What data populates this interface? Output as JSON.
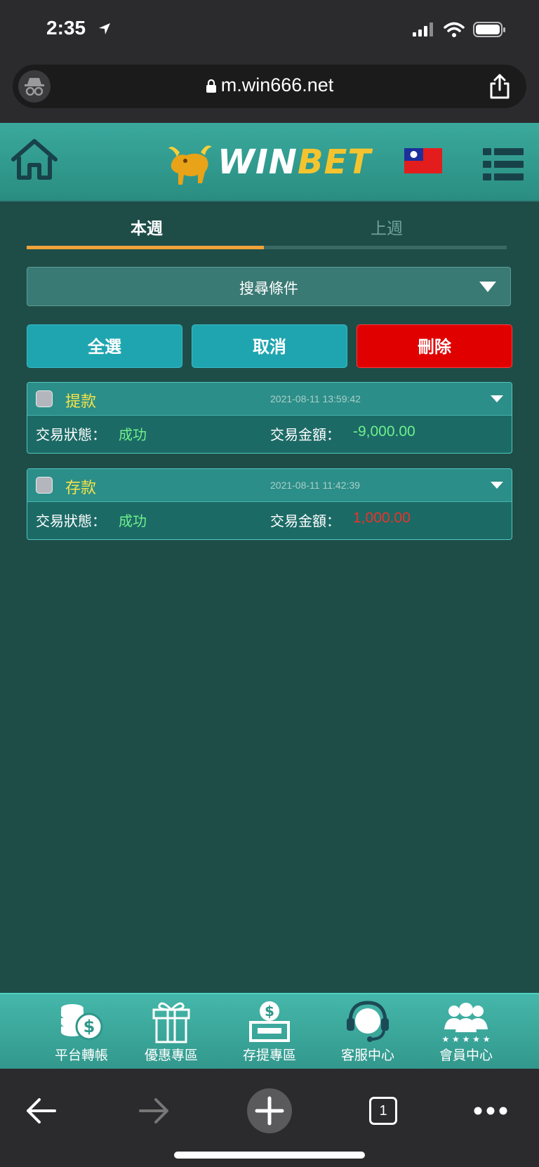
{
  "status_bar": {
    "time": "2:35"
  },
  "browser": {
    "url": "m.win666.net"
  },
  "header": {
    "logo_win": "WIN",
    "logo_bet": "BET"
  },
  "tabs": [
    {
      "label": "本週",
      "active": true
    },
    {
      "label": "上週",
      "active": false
    }
  ],
  "search": {
    "label": "搜尋條件"
  },
  "actions": {
    "select_all": "全選",
    "cancel": "取消",
    "delete": "刪除"
  },
  "records": [
    {
      "type": "提款",
      "timestamp": "2021-08-11 13:59:42",
      "status_label": "交易狀態：",
      "status": "成功",
      "amount_label": "交易金額：",
      "amount": "-9,000.00",
      "amount_color": "#6ef08c"
    },
    {
      "type": "存款",
      "timestamp": "2021-08-11 11:42:39",
      "status_label": "交易狀態：",
      "status": "成功",
      "amount_label": "交易金額：",
      "amount": "1,000.00",
      "amount_color": "#e8342a"
    }
  ],
  "bottom_nav": [
    {
      "label": "平台轉帳",
      "icon": "coins-dollar-icon"
    },
    {
      "label": "優惠專區",
      "icon": "gift-icon"
    },
    {
      "label": "存提專區",
      "icon": "deposit-icon"
    },
    {
      "label": "客服中心",
      "icon": "headset-icon"
    },
    {
      "label": "會員中心",
      "icon": "members-icon"
    }
  ],
  "safari_toolbar": {
    "tab_count": "1"
  },
  "colors": {
    "accent": "#f0a23a",
    "delete": "#e00000",
    "primary_button": "#1fa5b0",
    "background": "#1e4d48"
  }
}
